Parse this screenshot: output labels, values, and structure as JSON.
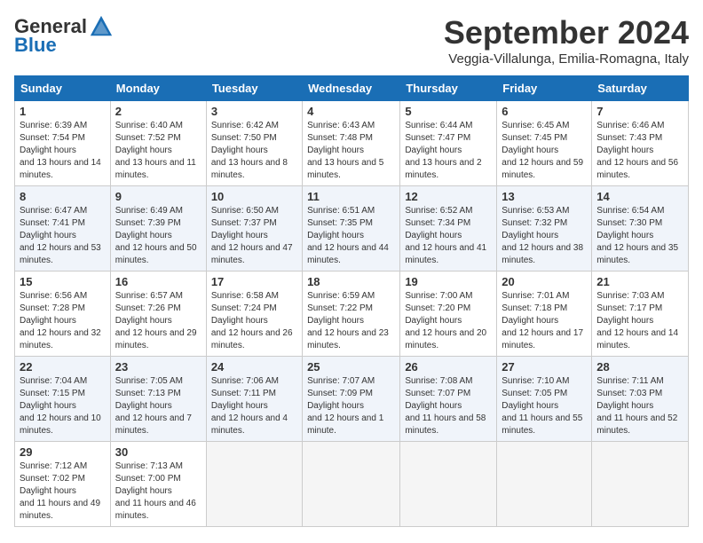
{
  "logo": {
    "general": "General",
    "blue": "Blue"
  },
  "title": "September 2024",
  "location": "Veggia-Villalunga, Emilia-Romagna, Italy",
  "days_of_week": [
    "Sunday",
    "Monday",
    "Tuesday",
    "Wednesday",
    "Thursday",
    "Friday",
    "Saturday"
  ],
  "weeks": [
    [
      {
        "day": "1",
        "sunrise": "6:39 AM",
        "sunset": "7:54 PM",
        "daylight": "13 hours and 14 minutes."
      },
      {
        "day": "2",
        "sunrise": "6:40 AM",
        "sunset": "7:52 PM",
        "daylight": "13 hours and 11 minutes."
      },
      {
        "day": "3",
        "sunrise": "6:42 AM",
        "sunset": "7:50 PM",
        "daylight": "13 hours and 8 minutes."
      },
      {
        "day": "4",
        "sunrise": "6:43 AM",
        "sunset": "7:48 PM",
        "daylight": "13 hours and 5 minutes."
      },
      {
        "day": "5",
        "sunrise": "6:44 AM",
        "sunset": "7:47 PM",
        "daylight": "13 hours and 2 minutes."
      },
      {
        "day": "6",
        "sunrise": "6:45 AM",
        "sunset": "7:45 PM",
        "daylight": "12 hours and 59 minutes."
      },
      {
        "day": "7",
        "sunrise": "6:46 AM",
        "sunset": "7:43 PM",
        "daylight": "12 hours and 56 minutes."
      }
    ],
    [
      {
        "day": "8",
        "sunrise": "6:47 AM",
        "sunset": "7:41 PM",
        "daylight": "12 hours and 53 minutes."
      },
      {
        "day": "9",
        "sunrise": "6:49 AM",
        "sunset": "7:39 PM",
        "daylight": "12 hours and 50 minutes."
      },
      {
        "day": "10",
        "sunrise": "6:50 AM",
        "sunset": "7:37 PM",
        "daylight": "12 hours and 47 minutes."
      },
      {
        "day": "11",
        "sunrise": "6:51 AM",
        "sunset": "7:35 PM",
        "daylight": "12 hours and 44 minutes."
      },
      {
        "day": "12",
        "sunrise": "6:52 AM",
        "sunset": "7:34 PM",
        "daylight": "12 hours and 41 minutes."
      },
      {
        "day": "13",
        "sunrise": "6:53 AM",
        "sunset": "7:32 PM",
        "daylight": "12 hours and 38 minutes."
      },
      {
        "day": "14",
        "sunrise": "6:54 AM",
        "sunset": "7:30 PM",
        "daylight": "12 hours and 35 minutes."
      }
    ],
    [
      {
        "day": "15",
        "sunrise": "6:56 AM",
        "sunset": "7:28 PM",
        "daylight": "12 hours and 32 minutes."
      },
      {
        "day": "16",
        "sunrise": "6:57 AM",
        "sunset": "7:26 PM",
        "daylight": "12 hours and 29 minutes."
      },
      {
        "day": "17",
        "sunrise": "6:58 AM",
        "sunset": "7:24 PM",
        "daylight": "12 hours and 26 minutes."
      },
      {
        "day": "18",
        "sunrise": "6:59 AM",
        "sunset": "7:22 PM",
        "daylight": "12 hours and 23 minutes."
      },
      {
        "day": "19",
        "sunrise": "7:00 AM",
        "sunset": "7:20 PM",
        "daylight": "12 hours and 20 minutes."
      },
      {
        "day": "20",
        "sunrise": "7:01 AM",
        "sunset": "7:18 PM",
        "daylight": "12 hours and 17 minutes."
      },
      {
        "day": "21",
        "sunrise": "7:03 AM",
        "sunset": "7:17 PM",
        "daylight": "12 hours and 14 minutes."
      }
    ],
    [
      {
        "day": "22",
        "sunrise": "7:04 AM",
        "sunset": "7:15 PM",
        "daylight": "12 hours and 10 minutes."
      },
      {
        "day": "23",
        "sunrise": "7:05 AM",
        "sunset": "7:13 PM",
        "daylight": "12 hours and 7 minutes."
      },
      {
        "day": "24",
        "sunrise": "7:06 AM",
        "sunset": "7:11 PM",
        "daylight": "12 hours and 4 minutes."
      },
      {
        "day": "25",
        "sunrise": "7:07 AM",
        "sunset": "7:09 PM",
        "daylight": "12 hours and 1 minute."
      },
      {
        "day": "26",
        "sunrise": "7:08 AM",
        "sunset": "7:07 PM",
        "daylight": "11 hours and 58 minutes."
      },
      {
        "day": "27",
        "sunrise": "7:10 AM",
        "sunset": "7:05 PM",
        "daylight": "11 hours and 55 minutes."
      },
      {
        "day": "28",
        "sunrise": "7:11 AM",
        "sunset": "7:03 PM",
        "daylight": "11 hours and 52 minutes."
      }
    ],
    [
      {
        "day": "29",
        "sunrise": "7:12 AM",
        "sunset": "7:02 PM",
        "daylight": "11 hours and 49 minutes."
      },
      {
        "day": "30",
        "sunrise": "7:13 AM",
        "sunset": "7:00 PM",
        "daylight": "11 hours and 46 minutes."
      },
      null,
      null,
      null,
      null,
      null
    ]
  ]
}
